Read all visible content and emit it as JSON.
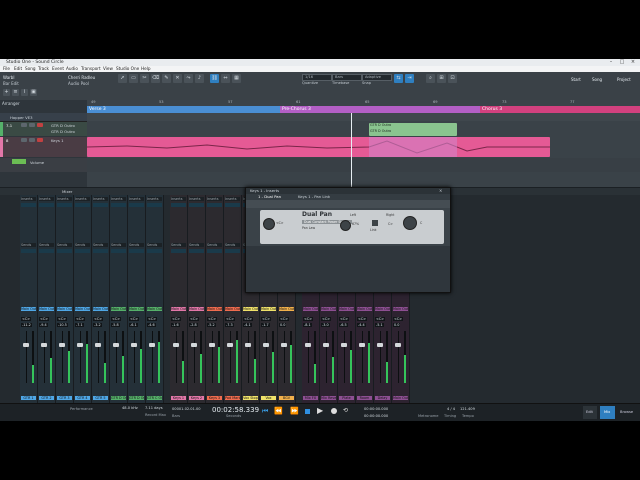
{
  "window": {
    "title": "Studio One - Sound Circle"
  },
  "menu": [
    "File",
    "Edit",
    "Song",
    "Track",
    "Event",
    "Audio",
    "Transport",
    "View",
    "Studio One",
    "Help"
  ],
  "toolbar": {
    "song_name": "Warbl",
    "song_sub": "Bar Edit",
    "user": "Cherri Radleu",
    "user_sub": "Audio Pool",
    "quantize": "1/16",
    "quantize_label": "Quantize",
    "timebase": "Bars",
    "timebase_label": "Timebase",
    "snap": "Adaptive",
    "snap_label": "Snap",
    "start": "Start",
    "song": "Song",
    "project": "Project"
  },
  "arrange": {
    "title": "Arranger",
    "ruler": [
      "49",
      "53",
      "57",
      "61",
      "65",
      "69",
      "73",
      "77"
    ],
    "markers": [
      "Verse 3",
      "Pre-Chorus 3",
      "Chorus 3"
    ],
    "tracks": [
      {
        "name": "Hopper VE3",
        "num": ""
      },
      {
        "name": "GTR D Outro",
        "num": "7-1"
      },
      {
        "name": "GTR D Outro",
        "num": "7-2"
      },
      {
        "name": "Keys 1",
        "num": "8"
      },
      {
        "name": "Volume",
        "num": ""
      }
    ],
    "clip_labels": [
      "GTR D Outro",
      "GTR D Outro"
    ]
  },
  "console_bar": {
    "label": "Mixer"
  },
  "plugin": {
    "title": "Keys 1 - Inserts",
    "tab": "1 - Dual Pan",
    "tab2": "Keys 1 - Pan Link",
    "name": "Dual Pan",
    "preset": "Dual Constant Power Sin/Cos",
    "mode": "Pan Law",
    "left_label": "Left",
    "right_label": "Right",
    "left_value": "<C>",
    "right_value": "C>",
    "input_label": "Input L/R",
    "link_label": "Link",
    "value_l": "67%",
    "value_r": "C"
  },
  "strips": [
    {
      "name": "GTR 1",
      "color": "#4fa7e6",
      "vol": "-11.2",
      "pan": "<C>"
    },
    {
      "name": "GTR 2",
      "color": "#4fa7e6",
      "vol": "-9.4",
      "pan": "<C>"
    },
    {
      "name": "GTR 3",
      "color": "#4fa7e6",
      "vol": "-10.5",
      "pan": "<C>"
    },
    {
      "name": "GTR 4",
      "color": "#4fa7e6",
      "vol": "-7.1",
      "pan": "<C>"
    },
    {
      "name": "GTR 5",
      "color": "#4fa7e6",
      "vol": "-3.2",
      "pan": "<C>"
    },
    {
      "name": "GTR D Outro",
      "color": "#55b06a",
      "vol": "-5.8",
      "pan": "<C>"
    },
    {
      "name": "GTR D Outro",
      "color": "#55b06a",
      "vol": "-6.1",
      "pan": "<C>"
    },
    {
      "name": "GTR C Outro",
      "color": "#55b06a",
      "vol": "-4.6",
      "pan": "<C>"
    },
    {
      "name": "Keys 1",
      "color": "#e277a8",
      "vol": "-1.6",
      "pan": "<C>"
    },
    {
      "name": "Keys 2",
      "color": "#e277a8",
      "vol": "-2.8",
      "pan": "<C>"
    },
    {
      "name": "Keys 3",
      "color": "#f06c4f",
      "vol": "-5.2",
      "pan": "<C>"
    },
    {
      "name": "Pad Marimba",
      "color": "#f06c4f",
      "vol": "-7.3",
      "pan": "<C>"
    },
    {
      "name": "Vox Stop",
      "color": "#f0e26a",
      "vol": "-4.1",
      "pan": "<C>"
    },
    {
      "name": "Vox",
      "color": "#f0e26a",
      "vol": "-1.7",
      "pan": "<C>"
    },
    {
      "name": "BGV",
      "color": "#f2b14c",
      "vol": "0.0",
      "pan": "<C>"
    },
    {
      "name": "Mix FX",
      "color": "#8d4f92",
      "vol": "-8.1",
      "pan": "<C>"
    },
    {
      "name": "Mix Reverb",
      "color": "#8d4f92",
      "vol": "-3.0",
      "pan": "<C>"
    },
    {
      "name": "Plate",
      "color": "#8d4f92",
      "vol": "-6.5",
      "pan": "<C>"
    },
    {
      "name": "Room",
      "color": "#8d4f92",
      "vol": "-4.4",
      "pan": "<C>"
    },
    {
      "name": "Delay",
      "color": "#8d4f92",
      "vol": "-5.1",
      "pan": "<C>"
    },
    {
      "name": "Main Out",
      "color": "#8d4f92",
      "vol": "0.0",
      "pan": "<C>"
    }
  ],
  "console_labels": {
    "inserts": "Inserts",
    "sends": "Sends",
    "main_out": "Main Out"
  },
  "status": {
    "sample_rate": "48.0 kHz",
    "buffer": "7.11 days",
    "record_max": "Record Max",
    "time_primary": "00:02:58.339",
    "time_secondary": "00001.02.01.00",
    "seconds": "Seconds",
    "bars": "Bars",
    "loop_start": "00:00:00.000",
    "loop_end": "00:00:00.000",
    "signature": "4 / 4",
    "tempo": "121.409",
    "metronome": "Metronome",
    "timing": "Timing",
    "tempo_label": "Tempo",
    "performance": "Performance",
    "edit": "Edit",
    "mix": "Mix",
    "browse": "Browse"
  }
}
